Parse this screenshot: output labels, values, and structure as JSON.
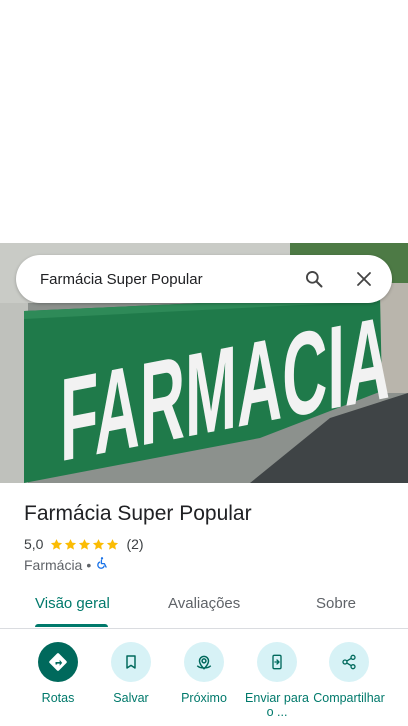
{
  "search": {
    "query": "Farmácia Super Popular"
  },
  "photo": {
    "sign_text": "FARMACIA"
  },
  "place": {
    "title": "Farmácia Super Popular",
    "rating": "5,0",
    "stars": 5,
    "review_count": "(2)",
    "category": "Farmácia",
    "separator": "•"
  },
  "tabs": [
    {
      "label": "Visão geral",
      "active": true
    },
    {
      "label": "Avaliações",
      "active": false
    },
    {
      "label": "Sobre",
      "active": false
    }
  ],
  "actions": [
    {
      "label": "Rotas",
      "icon": "directions-icon"
    },
    {
      "label": "Salvar",
      "icon": "bookmark-icon"
    },
    {
      "label": "Próximo",
      "icon": "nearby-icon"
    },
    {
      "label": "Enviar para o ...",
      "icon": "send-to-phone-icon"
    },
    {
      "label": "Compartilhar",
      "icon": "share-icon"
    }
  ],
  "colors": {
    "accent": "#00796b",
    "primary_button": "#00695c",
    "action_bg": "#d7f2f6",
    "star": "#fbbc04",
    "sign_green": "#1f7a4a"
  }
}
